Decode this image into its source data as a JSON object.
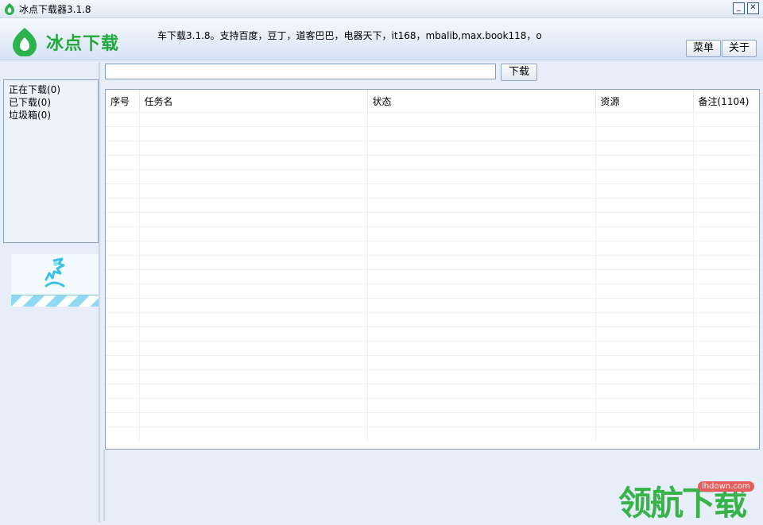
{
  "window": {
    "title": "冰点下载器3.1.8",
    "minimize_label": "_",
    "close_label": "✕"
  },
  "header": {
    "logo_text": "冰点下载",
    "marquee": "车下载3.1.8。支持百度，豆丁，道客巴巴，电器天下，it168，mbalib,max.book118，o",
    "menu_label": "菜单",
    "about_label": "关于"
  },
  "toolbar": {
    "url_value": "",
    "download_label": "下载"
  },
  "categories": [
    {
      "label": "正在下载(0)"
    },
    {
      "label": "已下载(0)"
    },
    {
      "label": "垃圾箱(0)"
    }
  ],
  "table": {
    "columns": [
      "序号",
      "任务名",
      "状态",
      "资源",
      "备注(1104)"
    ],
    "rows": []
  },
  "watermark": {
    "text": "领航下载",
    "url": "lhdown.com"
  },
  "colors": {
    "brand_green": "#22a83a",
    "window_bg": "#e7eefa",
    "border": "#8c9fb9"
  }
}
